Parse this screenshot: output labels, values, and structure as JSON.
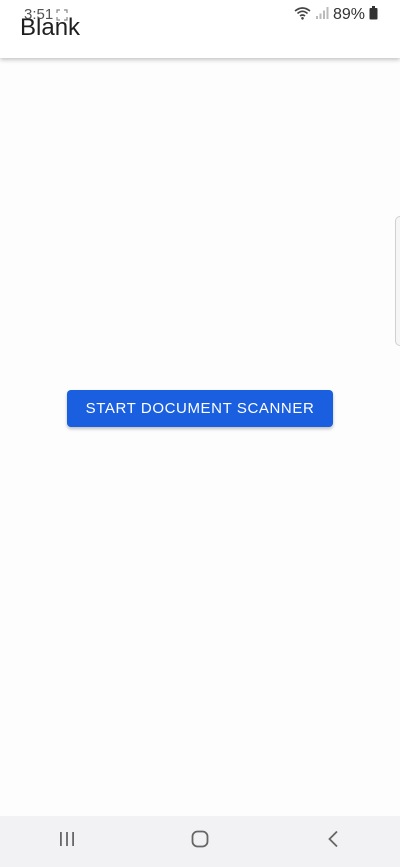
{
  "status_bar": {
    "time": "3:51",
    "battery_percent": "89%",
    "icons": [
      "notification-icon",
      "wifi-icon",
      "signal-icon",
      "battery-icon"
    ]
  },
  "app_bar": {
    "title": "Blank"
  },
  "main": {
    "scan_button_label": "START DOCUMENT SCANNER",
    "accent_color": "#1a5fe0"
  },
  "nav_bar": {
    "icons": [
      "recent-apps-icon",
      "home-icon",
      "back-icon"
    ]
  }
}
